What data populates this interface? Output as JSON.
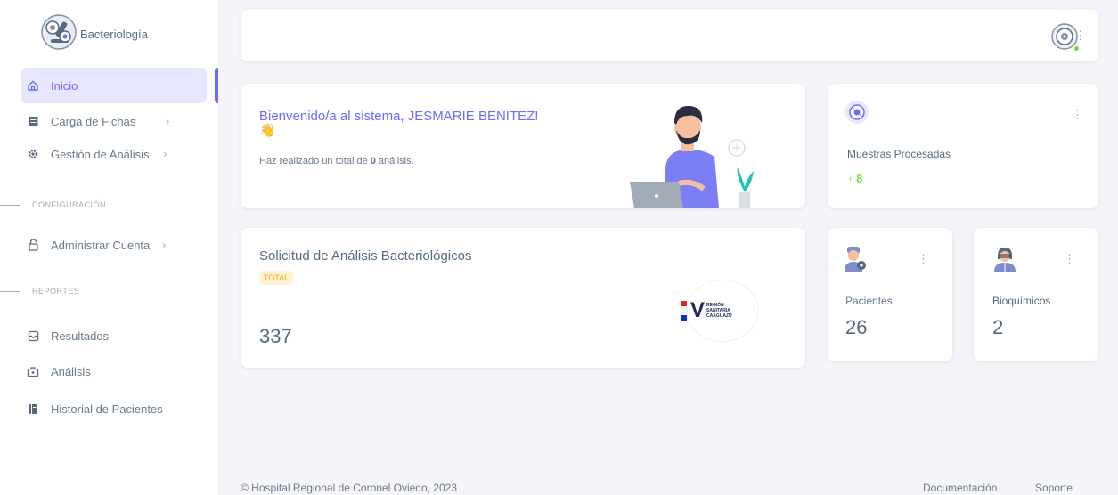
{
  "brand": {
    "name": "Bacteriología"
  },
  "sidebar": {
    "items": [
      {
        "label": "Inicio",
        "icon": "home-icon"
      },
      {
        "label": "Carga de Fichas",
        "icon": "file-icon",
        "chevron": "›"
      },
      {
        "label": "Gestión de Análisis",
        "icon": "gear-icon",
        "chevron": "›"
      },
      {
        "label": "Administrar Cuenta",
        "icon": "lock-icon",
        "chevron": "›"
      },
      {
        "label": "Resultados",
        "icon": "inbox-icon"
      },
      {
        "label": "Análisis",
        "icon": "briefcase-icon"
      },
      {
        "label": "Historial de Pacientes",
        "icon": "book-icon"
      }
    ],
    "headers": {
      "config": "CONFIGURACIÓN",
      "reports": "REPORTES"
    },
    "accent": "#696cff"
  },
  "welcome": {
    "title": "Bienvenido/a al sistema, JESMARIE BENITEZ!",
    "emoji": "👋",
    "subtitle_prefix": "Haz realizado un total de ",
    "count": "0",
    "subtitle_suffix": " análisis."
  },
  "muestras": {
    "label": "Muestras Procesadas",
    "arrow": "↑",
    "value": "8"
  },
  "solicitud": {
    "title": "Solicitud de Análisis Bacteriológicos",
    "badge": "TOTAL",
    "value": "337",
    "logo_text": [
      "REGIÓN",
      "SANITARIA",
      "CAAGUAZÚ"
    ]
  },
  "pacientes": {
    "label": "Pacientes",
    "value": "26"
  },
  "bioquimicos": {
    "label": "Bioquímicos",
    "value": "2"
  },
  "kebab": "⋮",
  "footer": {
    "copyright": "© Hospital Regional de Coronel Oviedo, 2023",
    "links": [
      "Documentación",
      "Soporte"
    ]
  }
}
